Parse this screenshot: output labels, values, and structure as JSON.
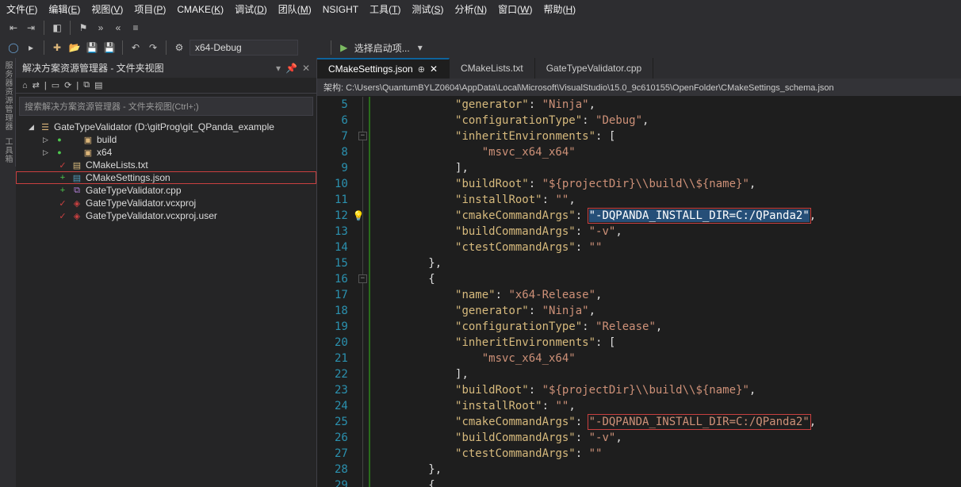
{
  "menu": {
    "items": [
      "文件(F)",
      "编辑(E)",
      "视图(V)",
      "项目(P)",
      "CMAKE(K)",
      "调试(D)",
      "团队(M)",
      "NSIGHT",
      "工具(T)",
      "测试(S)",
      "分析(N)",
      "窗口(W)",
      "帮助(H)"
    ]
  },
  "toolbar2": {
    "config": "x64-Debug",
    "start": "选择启动项..."
  },
  "explorer": {
    "title": "解决方案资源管理器 - 文件夹视图",
    "search_placeholder": "搜索解决方案资源管理器 - 文件夹视图(Ctrl+;)",
    "root": "GateTypeValidator (D:\\gitProg\\git_QPanda_example",
    "items": [
      {
        "name": "build",
        "type": "folder"
      },
      {
        "name": "x64",
        "type": "folder"
      },
      {
        "name": "CMakeLists.txt",
        "type": "txt",
        "mark": "check"
      },
      {
        "name": "CMakeSettings.json",
        "type": "json",
        "mark": "plus",
        "selected": true
      },
      {
        "name": "GateTypeValidator.cpp",
        "type": "cpp",
        "mark": "plus"
      },
      {
        "name": "GateTypeValidator.vcxproj",
        "type": "proj",
        "mark": "check"
      },
      {
        "name": "GateTypeValidator.vcxproj.user",
        "type": "proj",
        "mark": "check"
      }
    ]
  },
  "tabs": [
    {
      "label": "CMakeSettings.json",
      "active": true,
      "dirty": true
    },
    {
      "label": "CMakeLists.txt"
    },
    {
      "label": "GateTypeValidator.cpp"
    }
  ],
  "schema_bar": "架构: C:\\Users\\QuantumBYLZ0604\\AppData\\Local\\Microsoft\\VisualStudio\\15.0_9c610155\\OpenFolder\\CMakeSettings_schema.json",
  "code": {
    "first_line": 5,
    "lines": [
      [
        [
          "k",
          "\"generator\""
        ],
        [
          "p",
          ": "
        ],
        [
          "s",
          "\"Ninja\""
        ],
        [
          "p",
          ","
        ]
      ],
      [
        [
          "k",
          "\"configurationType\""
        ],
        [
          "p",
          ": "
        ],
        [
          "s",
          "\"Debug\""
        ],
        [
          "p",
          ","
        ]
      ],
      [
        [
          "k",
          "\"inheritEnvironments\""
        ],
        [
          "p",
          ": ["
        ]
      ],
      [
        [
          "s",
          "\"msvc_x64_x64\""
        ]
      ],
      [
        [
          "p",
          "],"
        ]
      ],
      [
        [
          "k",
          "\"buildRoot\""
        ],
        [
          "p",
          ": "
        ],
        [
          "s",
          "\"${projectDir}\\\\build\\\\${name}\""
        ],
        [
          "p",
          ","
        ]
      ],
      [
        [
          "k",
          "\"installRoot\""
        ],
        [
          "p",
          ": "
        ],
        [
          "s",
          "\"\""
        ],
        [
          "p",
          ","
        ]
      ],
      [
        [
          "k",
          "\"cmakeCommandArgs\""
        ],
        [
          "p",
          ": "
        ],
        [
          "sel",
          "\"-DQPANDA_INSTALL_DIR=C:/QPanda2\""
        ],
        [
          "p",
          ","
        ]
      ],
      [
        [
          "k",
          "\"buildCommandArgs\""
        ],
        [
          "p",
          ": "
        ],
        [
          "s",
          "\"-v\""
        ],
        [
          "p",
          ","
        ]
      ],
      [
        [
          "k",
          "\"ctestCommandArgs\""
        ],
        [
          "p",
          ": "
        ],
        [
          "s",
          "\"\""
        ]
      ],
      [
        [
          "p",
          "},"
        ]
      ],
      [
        [
          "p",
          "{"
        ]
      ],
      [
        [
          "k",
          "\"name\""
        ],
        [
          "p",
          ": "
        ],
        [
          "s",
          "\"x64-Release\""
        ],
        [
          "p",
          ","
        ]
      ],
      [
        [
          "k",
          "\"generator\""
        ],
        [
          "p",
          ": "
        ],
        [
          "s",
          "\"Ninja\""
        ],
        [
          "p",
          ","
        ]
      ],
      [
        [
          "k",
          "\"configurationType\""
        ],
        [
          "p",
          ": "
        ],
        [
          "s",
          "\"Release\""
        ],
        [
          "p",
          ","
        ]
      ],
      [
        [
          "k",
          "\"inheritEnvironments\""
        ],
        [
          "p",
          ": ["
        ]
      ],
      [
        [
          "s",
          "\"msvc_x64_x64\""
        ]
      ],
      [
        [
          "p",
          "],"
        ]
      ],
      [
        [
          "k",
          "\"buildRoot\""
        ],
        [
          "p",
          ": "
        ],
        [
          "s",
          "\"${projectDir}\\\\build\\\\${name}\""
        ],
        [
          "p",
          ","
        ]
      ],
      [
        [
          "k",
          "\"installRoot\""
        ],
        [
          "p",
          ": "
        ],
        [
          "s",
          "\"\""
        ],
        [
          "p",
          ","
        ]
      ],
      [
        [
          "k",
          "\"cmakeCommandArgs\""
        ],
        [
          "p",
          ": "
        ],
        [
          "box",
          "\"-DQPANDA_INSTALL_DIR=C:/QPanda2\""
        ],
        [
          "p",
          ","
        ]
      ],
      [
        [
          "k",
          "\"buildCommandArgs\""
        ],
        [
          "p",
          ": "
        ],
        [
          "s",
          "\"-v\""
        ],
        [
          "p",
          ","
        ]
      ],
      [
        [
          "k",
          "\"ctestCommandArgs\""
        ],
        [
          "p",
          ": "
        ],
        [
          "s",
          "\"\""
        ]
      ],
      [
        [
          "p",
          "},"
        ]
      ],
      [
        [
          "p",
          "{"
        ]
      ]
    ],
    "indents": [
      6,
      6,
      6,
      8,
      6,
      6,
      6,
      6,
      6,
      6,
      4,
      4,
      6,
      6,
      6,
      6,
      8,
      6,
      6,
      6,
      6,
      6,
      6,
      4,
      4
    ],
    "fold_minus": [
      7,
      16
    ],
    "bulb_line": 12,
    "boxred_lines": [
      12,
      25
    ]
  },
  "side_tabs": [
    "服务器资源管理器",
    "工具箱"
  ]
}
